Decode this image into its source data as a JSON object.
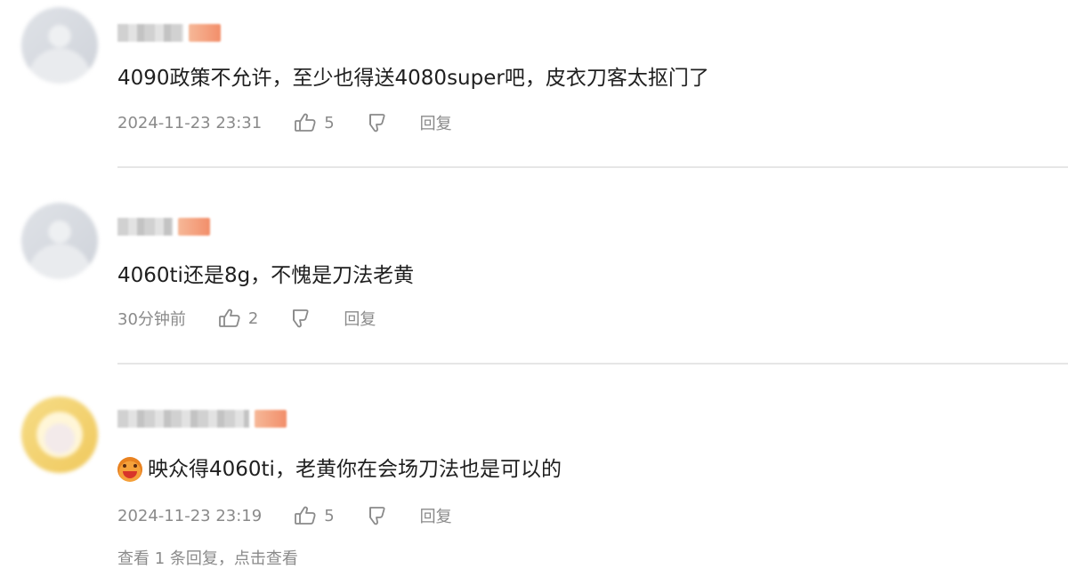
{
  "comments": [
    {
      "text": "4090政策不允许，至少也得送4080super吧，皮衣刀客太抠门了",
      "time": "2024-11-23 23:31",
      "likes": "5",
      "reply_label": "回复",
      "avatar_color": "#d6d9df"
    },
    {
      "text": "4060ti还是8g，不愧是刀法老黄",
      "time": "30分钟前",
      "likes": "2",
      "reply_label": "回复",
      "avatar_color": "#d6d9df"
    },
    {
      "text": "映众得4060ti，老黄你在会场刀法也是可以的",
      "emoji": "blush-emoji",
      "time": "2024-11-23 23:19",
      "likes": "5",
      "reply_label": "回复",
      "view_replies": "查看 1 条回复，点击查看",
      "avatar_color": "#f2d27a"
    }
  ],
  "icons": {
    "like": "thumbs-up-icon",
    "dislike": "thumbs-down-icon"
  },
  "colors": {
    "text": "#1f1f1f",
    "meta": "#8a8a8a",
    "divider": "#e6e6e6",
    "badge": "#f28e6a"
  }
}
